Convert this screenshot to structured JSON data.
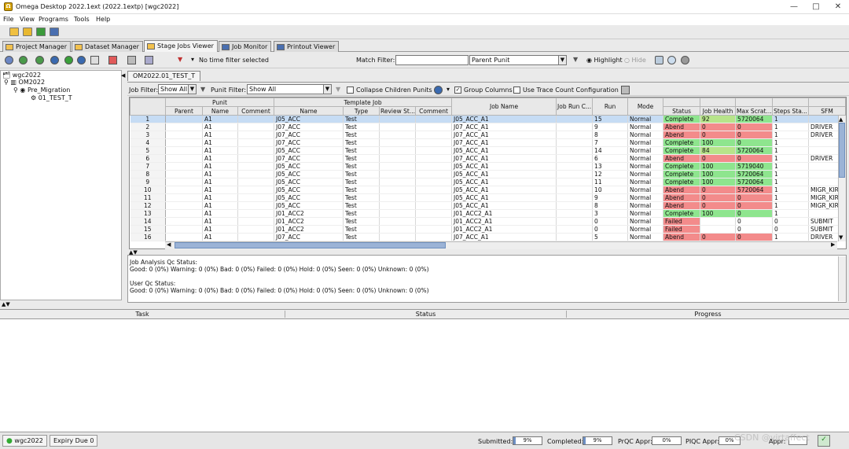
{
  "window": {
    "title": "Omega Desktop 2022.1ext (2022.1extp) [wgc2022]"
  },
  "menu": [
    "File",
    "View",
    "Programs",
    "Tools",
    "Help"
  ],
  "tabs": [
    "Project Manager",
    "Dataset Manager",
    "Stage Jobs Viewer",
    "Job Monitor",
    "Printout Viewer"
  ],
  "toolbar2": {
    "time_filter": "No time filter selected",
    "match_filter_label": "Match Filter:",
    "match_filter_value": "",
    "punit_select": "Parent Punit",
    "highlight": "Highlight",
    "hide": "Hide"
  },
  "tree": {
    "root": "wgc2022",
    "project": "OM2022",
    "stage": "Pre_Migration",
    "test": "01_TEST_T"
  },
  "subtab": "OM2022.01_TEST_T",
  "filters": {
    "job_filter_label": "Job Filter:",
    "job_filter_value": "Show All",
    "punit_filter_label": "Punit Filter:",
    "punit_filter_value": "Show All",
    "collapse": "Collapse Children Punits",
    "group_columns": "Group Columns",
    "trace_count": "Use Trace Count Configuration"
  },
  "grid": {
    "group_headers": {
      "punit": "Punit",
      "template_job": "Template Job"
    },
    "columns": [
      "Parent",
      "Name",
      "Comment",
      "Name",
      "Type",
      "Review St...",
      "Comment",
      "Job Name",
      "Job Run C...",
      "Run",
      "Mode",
      "Status",
      "Job Health",
      "Max Scrat...",
      "Steps Sta...",
      "SFM"
    ],
    "rows": [
      [
        "1",
        "",
        "A1",
        "",
        "J05_ACC",
        "Test",
        "",
        "",
        "J05_ACC_A1",
        "",
        "15",
        "Normal",
        "Complete",
        "92",
        "5720064",
        "1",
        ""
      ],
      [
        "2",
        "",
        "A1",
        "",
        "J07_ACC",
        "Test",
        "",
        "",
        "J07_ACC_A1",
        "",
        "9",
        "Normal",
        "Abend",
        "0",
        "0",
        "1",
        "DRIVER"
      ],
      [
        "3",
        "",
        "A1",
        "",
        "J07_ACC",
        "Test",
        "",
        "",
        "J07_ACC_A1",
        "",
        "8",
        "Normal",
        "Abend",
        "0",
        "0",
        "1",
        "DRIVER"
      ],
      [
        "4",
        "",
        "A1",
        "",
        "J07_ACC",
        "Test",
        "",
        "",
        "J07_ACC_A1",
        "",
        "7",
        "Normal",
        "Complete",
        "100",
        "0",
        "1",
        ""
      ],
      [
        "5",
        "",
        "A1",
        "",
        "J05_ACC",
        "Test",
        "",
        "",
        "J05_ACC_A1",
        "",
        "14",
        "Normal",
        "Complete",
        "84",
        "5720064",
        "1",
        ""
      ],
      [
        "6",
        "",
        "A1",
        "",
        "J07_ACC",
        "Test",
        "",
        "",
        "J07_ACC_A1",
        "",
        "6",
        "Normal",
        "Abend",
        "0",
        "0",
        "1",
        "DRIVER"
      ],
      [
        "7",
        "",
        "A1",
        "",
        "J05_ACC",
        "Test",
        "",
        "",
        "J05_ACC_A1",
        "",
        "13",
        "Normal",
        "Complete",
        "100",
        "5719040",
        "1",
        ""
      ],
      [
        "8",
        "",
        "A1",
        "",
        "J05_ACC",
        "Test",
        "",
        "",
        "J05_ACC_A1",
        "",
        "12",
        "Normal",
        "Complete",
        "100",
        "5720064",
        "1",
        ""
      ],
      [
        "9",
        "",
        "A1",
        "",
        "J05_ACC",
        "Test",
        "",
        "",
        "J05_ACC_A1",
        "",
        "11",
        "Normal",
        "Complete",
        "100",
        "5720064",
        "1",
        ""
      ],
      [
        "10",
        "",
        "A1",
        "",
        "J05_ACC",
        "Test",
        "",
        "",
        "J05_ACC_A1",
        "",
        "10",
        "Normal",
        "Abend",
        "0",
        "5720064",
        "1",
        "MIGR_KIR"
      ],
      [
        "11",
        "",
        "A1",
        "",
        "J05_ACC",
        "Test",
        "",
        "",
        "J05_ACC_A1",
        "",
        "9",
        "Normal",
        "Abend",
        "0",
        "0",
        "1",
        "MIGR_KIR"
      ],
      [
        "12",
        "",
        "A1",
        "",
        "J05_ACC",
        "Test",
        "",
        "",
        "J05_ACC_A1",
        "",
        "8",
        "Normal",
        "Abend",
        "0",
        "0",
        "1",
        "MIGR_KIR"
      ],
      [
        "13",
        "",
        "A1",
        "",
        "J01_ACC2",
        "Test",
        "",
        "",
        "J01_ACC2_A1",
        "",
        "3",
        "Normal",
        "Complete",
        "100",
        "0",
        "1",
        ""
      ],
      [
        "14",
        "",
        "A1",
        "",
        "J01_ACC2",
        "Test",
        "",
        "",
        "J01_ACC2_A1",
        "",
        "0",
        "Normal",
        "Failed",
        "",
        "0",
        "0",
        "SUBMIT"
      ],
      [
        "15",
        "",
        "A1",
        "",
        "J01_ACC2",
        "Test",
        "",
        "",
        "J01_ACC2_A1",
        "",
        "0",
        "Normal",
        "Failed",
        "",
        "0",
        "0",
        "SUBMIT"
      ],
      [
        "16",
        "",
        "A1",
        "",
        "J07_ACC",
        "Test",
        "",
        "",
        "J07_ACC_A1",
        "",
        "5",
        "Normal",
        "Abend",
        "0",
        "0",
        "1",
        "DRIVER"
      ]
    ]
  },
  "qc": {
    "job_label": "Job Analysis Qc Status:",
    "job_text": "Good: 0 (0%) Warning: 0 (0%) Bad: 0 (0%) Failed: 0 (0%) Hold: 0 (0%) Seen: 0 (0%) Unknown: 0 (0%)",
    "user_label": "User Qc Status:",
    "user_text": "Good: 0 (0%) Warning: 0 (0%) Bad: 0 (0%) Failed: 0 (0%) Hold: 0 (0%) Seen: 0 (0%) Unknown: 0 (0%)"
  },
  "tasks": {
    "task": "Task",
    "status": "Status",
    "progress": "Progress"
  },
  "statusbar": {
    "project": "wgc2022",
    "expiry": "Expiry Due 0",
    "submitted_label": "Submitted:",
    "submitted": "9%",
    "submitted_frac": 0.09,
    "completed_label": "Completed:",
    "completed": "9%",
    "completed_frac": 0.09,
    "prqc_label": "PrQC Appr:",
    "prqc": "0%",
    "piqc_label": "PIQC Appr:",
    "piqc": "0%",
    "appr_label": "Appr:",
    "watermark": "CSDN @virtaffect"
  }
}
